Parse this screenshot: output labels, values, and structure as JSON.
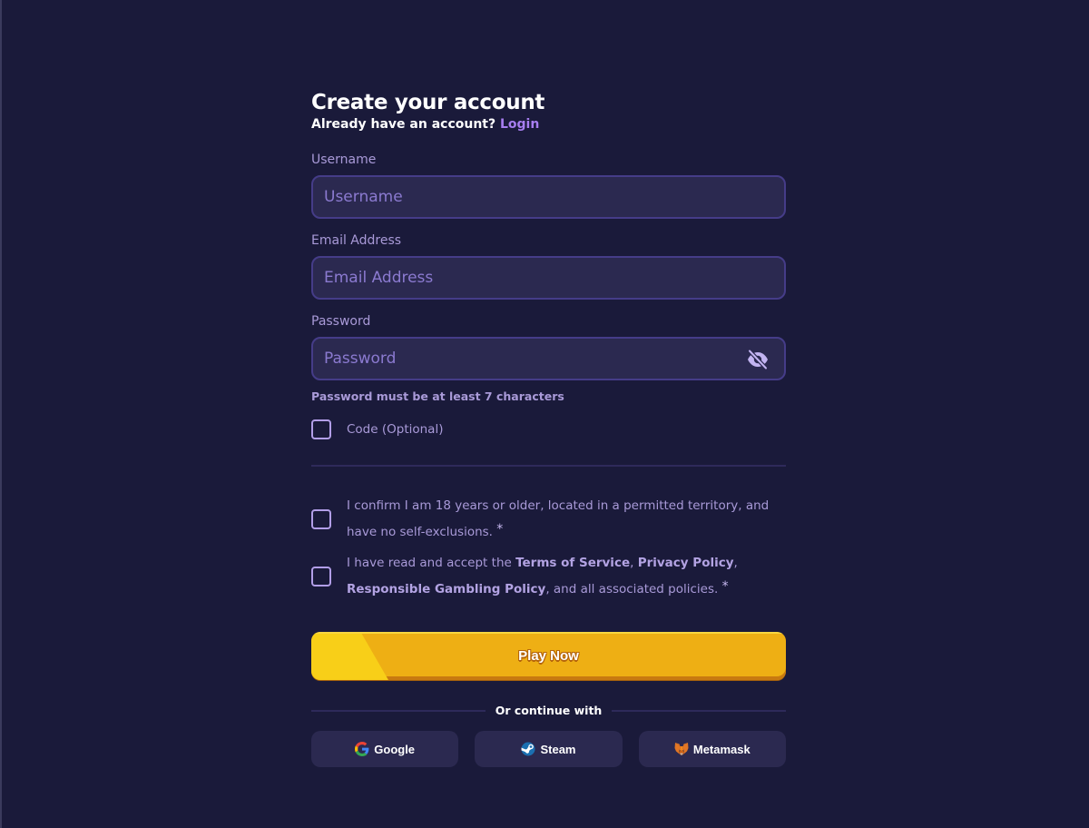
{
  "header": {
    "title": "Create your account",
    "subtitle_prefix": "Already have an account?",
    "login_link": "Login"
  },
  "fields": {
    "username": {
      "label": "Username",
      "placeholder": "Username",
      "value": ""
    },
    "email": {
      "label": "Email Address",
      "placeholder": "Email Address",
      "value": ""
    },
    "password": {
      "label": "Password",
      "placeholder": "Password",
      "value": "",
      "hint": "Password must be at least 7 characters",
      "visibility_icon": "eye-off-icon"
    }
  },
  "code": {
    "label": "Code (Optional)",
    "checked": false
  },
  "terms": {
    "age_confirm": {
      "text": "I confirm I am 18 years or older, located in a permitted territory, and have no self-exclusions.",
      "required_mark": "*",
      "checked": false
    },
    "policies": {
      "prefix": "I have read and accept the ",
      "terms_of_service": "Terms of Service",
      "sep1": ", ",
      "privacy_policy": "Privacy Policy",
      "sep2": ", ",
      "responsible_gambling": "Responsible Gambling Policy",
      "suffix": ", and all associated policies.",
      "required_mark": "*",
      "checked": false
    }
  },
  "submit": {
    "label": "Play Now"
  },
  "social": {
    "divider_text": "Or continue with",
    "providers": [
      {
        "label": "Google",
        "icon": "google-icon"
      },
      {
        "label": "Steam",
        "icon": "steam-icon"
      },
      {
        "label": "Metamask",
        "icon": "metamask-icon"
      }
    ]
  },
  "colors": {
    "background": "#1a1a3a",
    "input_bg": "#2b2950",
    "input_border": "#453c88",
    "accent": "#a77ef0",
    "label": "#a99ad8",
    "button_primary": "#eeaf14",
    "button_highlight": "#f8cf18"
  }
}
